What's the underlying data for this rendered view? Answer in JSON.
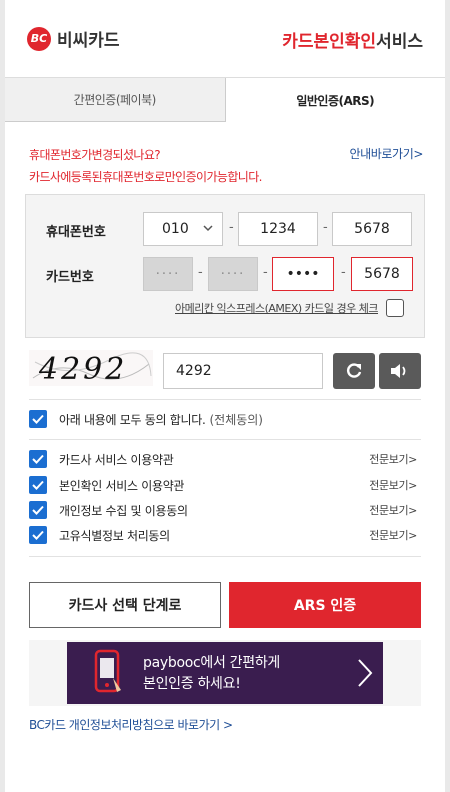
{
  "header": {
    "logo_mark": "BC",
    "logo_text": "비씨카드",
    "title_red": "카드본인확인",
    "title_dark": "서비스"
  },
  "tabs": [
    {
      "label": "간편인증(페이북)",
      "active": false
    },
    {
      "label": "일반인증(ARS)",
      "active": true
    }
  ],
  "notice": {
    "line1": "휴대폰번호가변경되셨나요?",
    "line2": "카드사에등록된휴대폰번호로만인증이가능합니다.",
    "guide_link": "안내바로가기>"
  },
  "form": {
    "phone_label": "휴대폰번호",
    "phone_prefix": "010",
    "phone_mid": "1234",
    "phone_last": "5678",
    "card_label": "카드번호",
    "card_seg1": "····",
    "card_seg2": "····",
    "card_seg3": "••••",
    "card_seg4": "5678",
    "amex_label": "아메리칸 익스프레스(AMEX) 카드일 경우 체크",
    "dash": "-"
  },
  "captcha": {
    "image_text": "4292",
    "input_value": "4292"
  },
  "agreements": {
    "all_label": "아래 내용에 모두 동의 합니다.",
    "all_sub": "(전체동의)",
    "detail_label": "전문보기>",
    "items": [
      {
        "label": "카드사 서비스 이용약관"
      },
      {
        "label": "본인확인 서비스 이용약관"
      },
      {
        "label": "개인정보 수집 및 이용동의"
      },
      {
        "label": "고유식별정보 처리동의"
      }
    ]
  },
  "buttons": {
    "back": "카드사 선택 단계로",
    "ars": "ARS 인증"
  },
  "banner": {
    "line1": "paybooc에서 간편하게",
    "line2": "본인인증 하세요!"
  },
  "footer": {
    "privacy_link": "BC카드 개인정보처리방침으로 바로가기 >"
  },
  "colors": {
    "brand_red": "#e0262e",
    "link_blue": "#1f4e96",
    "check_blue": "#1b6ed1",
    "banner_purple": "#3a1d4f"
  }
}
